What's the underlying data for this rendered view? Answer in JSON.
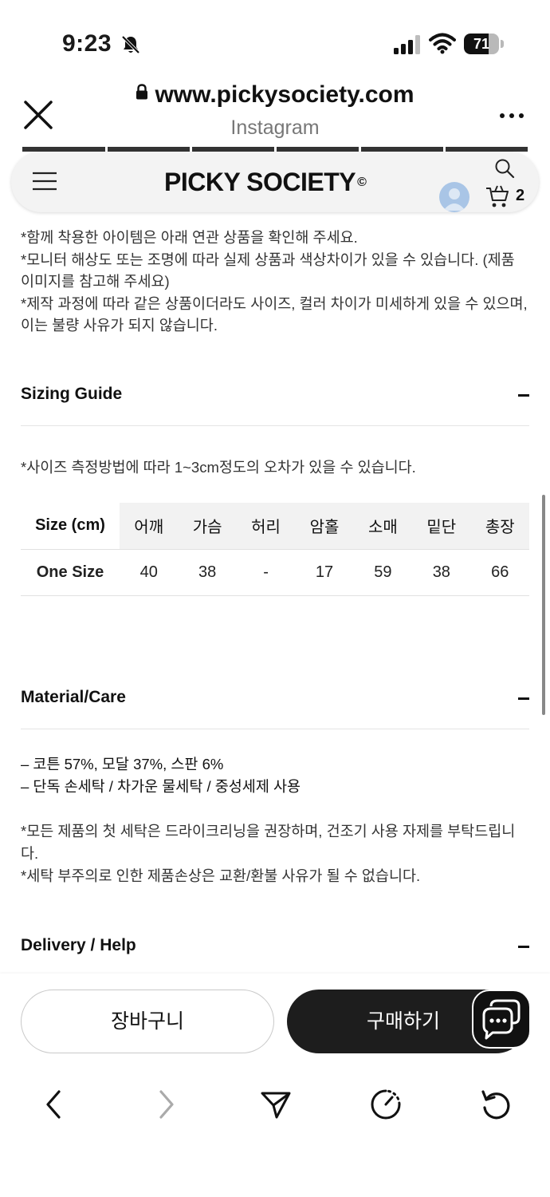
{
  "status_bar": {
    "time": "9:23",
    "battery_percent": "71",
    "battery_level": 0.71,
    "icons": [
      "bell-slash-icon",
      "cellular-signal-icon",
      "wifi-icon",
      "battery-icon"
    ]
  },
  "browser": {
    "url": "www.pickysociety.com",
    "source_label": "Instagram",
    "icons": [
      "close-icon",
      "lock-icon",
      "more-icon"
    ]
  },
  "site_header": {
    "brand": "PICKY SOCIETY",
    "brand_mark": "©",
    "cart_count": "2",
    "icons": [
      "menu-icon",
      "search-icon",
      "avatar",
      "cart-icon"
    ]
  },
  "product_notes": [
    "*함께 착용한 아이템은 아래 연관 상품을 확인해 주세요.",
    "*모니터 해상도 또는 조명에 따라 실제 상품과 색상차이가 있을 수 있습니다. (제품 이미지를 참고해 주세요)",
    "*제작 과정에 따라 같은 상품이더라도 사이즈, 컬러 차이가 미세하게 있을 수 있으며, 이는 불량 사유가 되지 않습니다."
  ],
  "sizing_guide": {
    "title": "Sizing Guide",
    "toggle": "collapse",
    "note": "*사이즈 측정방법에 따라 1~3cm정도의 오차가 있을 수 있습니다.",
    "headers": [
      "Size (cm)",
      "어깨",
      "가슴",
      "허리",
      "암홀",
      "소매",
      "밑단",
      "총장"
    ],
    "rows": [
      [
        "One Size",
        "40",
        "38",
        "-",
        "17",
        "59",
        "38",
        "66"
      ]
    ]
  },
  "material_care": {
    "title": "Material/Care",
    "lines": [
      "– 코튼 57%, 모달 37%, 스판 6%",
      "– 단독 손세탁 / 차가운 물세탁 / 중성세제 사용"
    ],
    "notes": [
      "*모든 제품의 첫 세탁은 드라이크리닝을 권장하며, 건조기 사용 자제를 부탁드립니다.",
      "*세탁 부주의로 인한 제품손상은 교환/환불 사유가 될 수 없습니다."
    ]
  },
  "delivery_help": {
    "title": "Delivery / Help"
  },
  "purchase_bar": {
    "cart_label": "장바구니",
    "buy_label": "구매하기",
    "chat_icon": "chat-icon"
  },
  "toolbar": {
    "icons": [
      "back-icon",
      "forward-icon",
      "share-icon",
      "compass-icon",
      "reload-icon"
    ]
  },
  "colors": {
    "buy_button": "#1d1d1d",
    "nav_background": "#f3f3f3",
    "avatar": "#a9c5e6",
    "table_header": "#f2f2f2"
  }
}
